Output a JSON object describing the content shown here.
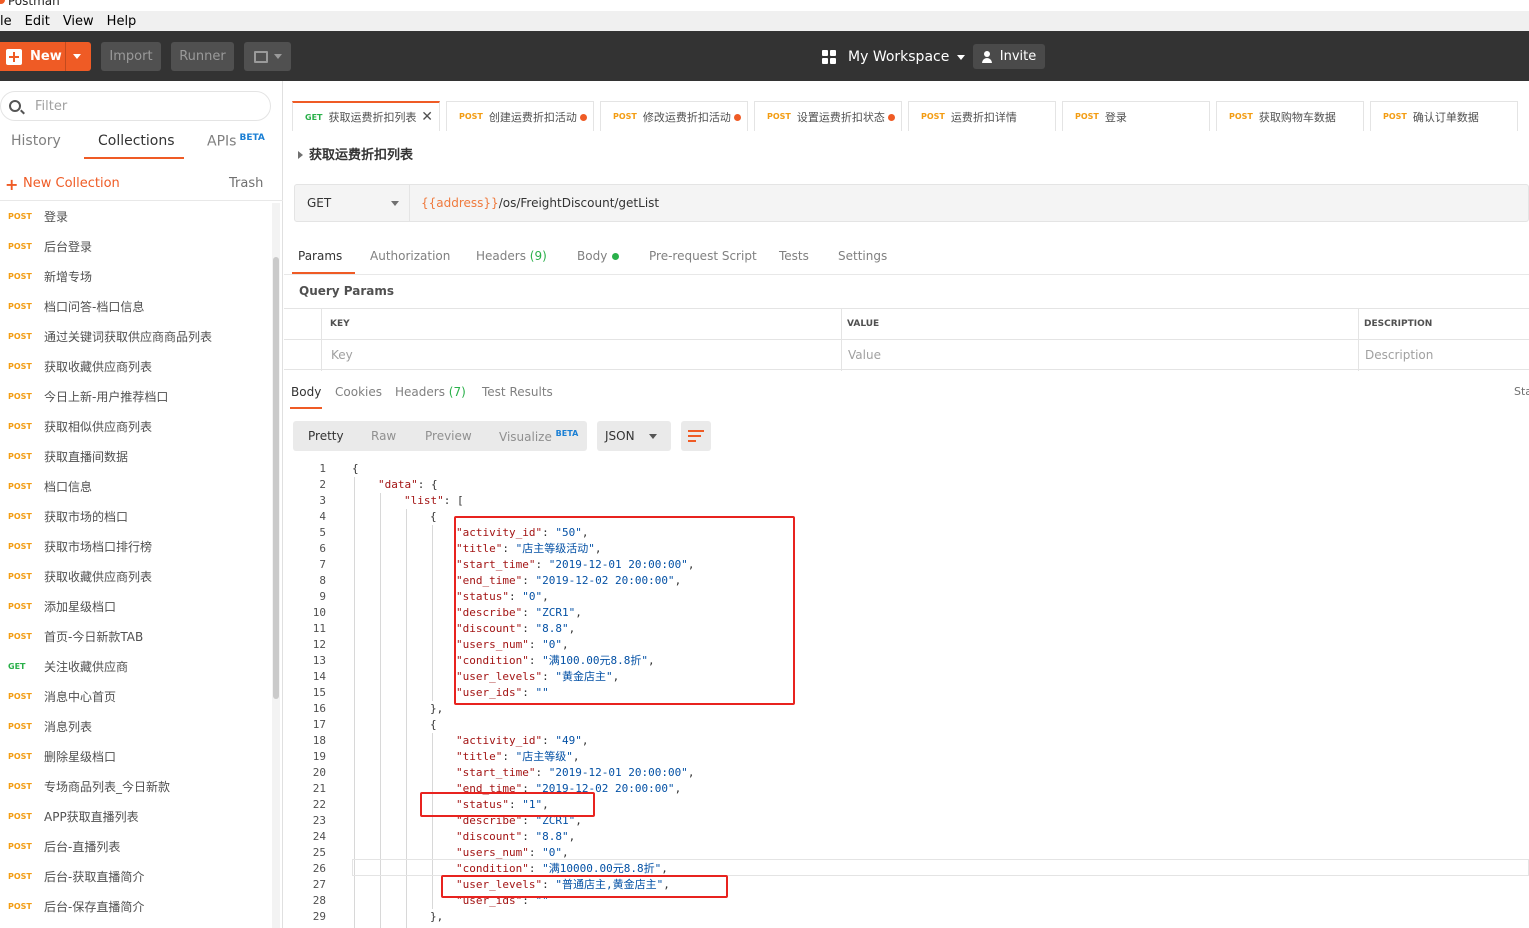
{
  "titlebar": {
    "title": "Postman"
  },
  "menu": [
    "le",
    "Edit",
    "View",
    "Help"
  ],
  "header": {
    "new_label": "New",
    "import_label": "Import",
    "runner_label": "Runner",
    "workspace_label": "My Workspace",
    "invite_label": "Invite"
  },
  "sidebar": {
    "filter_placeholder": "Filter",
    "tabs": {
      "history": "History",
      "collections": "Collections",
      "apis": "APIs",
      "apis_badge": "BETA"
    },
    "new_collection": "New Collection",
    "trash": "Trash",
    "items": [
      {
        "method": "POST",
        "name": "登录"
      },
      {
        "method": "POST",
        "name": "后台登录"
      },
      {
        "method": "POST",
        "name": "新增专场"
      },
      {
        "method": "POST",
        "name": "档口问答-档口信息"
      },
      {
        "method": "POST",
        "name": "通过关键词获取供应商商品列表"
      },
      {
        "method": "POST",
        "name": "获取收藏供应商列表"
      },
      {
        "method": "POST",
        "name": "今日上新-用户推荐档口"
      },
      {
        "method": "POST",
        "name": "获取相似供应商列表"
      },
      {
        "method": "POST",
        "name": "获取直播间数据"
      },
      {
        "method": "POST",
        "name": "档口信息"
      },
      {
        "method": "POST",
        "name": "获取市场的档口"
      },
      {
        "method": "POST",
        "name": "获取市场档口排行榜"
      },
      {
        "method": "POST",
        "name": "获取收藏供应商列表"
      },
      {
        "method": "POST",
        "name": "添加星级档口"
      },
      {
        "method": "POST",
        "name": "首页-今日新款TAB"
      },
      {
        "method": "GET",
        "name": "关注收藏供应商"
      },
      {
        "method": "POST",
        "name": "消息中心首页"
      },
      {
        "method": "POST",
        "name": "消息列表"
      },
      {
        "method": "POST",
        "name": "删除星级档口"
      },
      {
        "method": "POST",
        "name": "专场商品列表_今日新款"
      },
      {
        "method": "POST",
        "name": "APP获取直播列表"
      },
      {
        "method": "POST",
        "name": "后台-直播列表"
      },
      {
        "method": "POST",
        "name": "后台-获取直播简介"
      },
      {
        "method": "POST",
        "name": "后台-保存直播简介"
      }
    ]
  },
  "request_tabs": [
    {
      "method": "GET",
      "name": "获取运费折扣列表",
      "active": true
    },
    {
      "method": "POST",
      "name": "创建运费折扣活动",
      "dirty": true
    },
    {
      "method": "POST",
      "name": "修改运费折扣活动",
      "dirty": true
    },
    {
      "method": "POST",
      "name": "设置运费折扣状态",
      "dirty": true
    },
    {
      "method": "POST",
      "name": "运费折扣详情"
    },
    {
      "method": "POST",
      "name": "登录"
    },
    {
      "method": "POST",
      "name": "获取购物车数据"
    },
    {
      "method": "POST",
      "name": "确认订单数据"
    }
  ],
  "request": {
    "name": "获取运费折扣列表",
    "method": "GET",
    "url_var": "{{address}}",
    "url_path": "/os/FreightDiscount/getList"
  },
  "param_tabs": {
    "params": "Params",
    "authorization": "Authorization",
    "headers": "Headers",
    "headers_count": "(9)",
    "body": "Body",
    "prerequest": "Pre-request Script",
    "tests": "Tests",
    "settings": "Settings"
  },
  "query_params": {
    "title": "Query Params",
    "col_key": "KEY",
    "col_value": "VALUE",
    "col_desc": "DESCRIPTION",
    "ph_key": "Key",
    "ph_value": "Value",
    "ph_desc": "Description"
  },
  "response_tabs": {
    "body": "Body",
    "cookies": "Cookies",
    "headers": "Headers",
    "headers_count": "(7)",
    "test_results": "Test Results",
    "status_cut": "Sta"
  },
  "view_bar": {
    "pretty": "Pretty",
    "raw": "Raw",
    "preview": "Preview",
    "visualize": "Visualize",
    "visualize_badge": "BETA",
    "format": "JSON"
  },
  "code_lines": [
    {
      "n": "1",
      "ind": 0,
      "t": "{"
    },
    {
      "n": "2",
      "ind": 1,
      "k": "\"data\"",
      "t": ": {"
    },
    {
      "n": "3",
      "ind": 2,
      "k": "\"list\"",
      "t": ": ["
    },
    {
      "n": "4",
      "ind": 3,
      "t": "{"
    },
    {
      "n": "5",
      "ind": 4,
      "k": "\"activity_id\"",
      "v": "\"50\"",
      "t": ","
    },
    {
      "n": "6",
      "ind": 4,
      "k": "\"title\"",
      "v": "\"店主等级活动\"",
      "t": ","
    },
    {
      "n": "7",
      "ind": 4,
      "k": "\"start_time\"",
      "v": "\"2019-12-01 20:00:00\"",
      "t": ","
    },
    {
      "n": "8",
      "ind": 4,
      "k": "\"end_time\"",
      "v": "\"2019-12-02 20:00:00\"",
      "t": ","
    },
    {
      "n": "9",
      "ind": 4,
      "k": "\"status\"",
      "v": "\"0\"",
      "t": ","
    },
    {
      "n": "10",
      "ind": 4,
      "k": "\"describe\"",
      "v": "\"ZCR1\"",
      "t": ","
    },
    {
      "n": "11",
      "ind": 4,
      "k": "\"discount\"",
      "v": "\"8.8\"",
      "t": ","
    },
    {
      "n": "12",
      "ind": 4,
      "k": "\"users_num\"",
      "v": "\"0\"",
      "t": ","
    },
    {
      "n": "13",
      "ind": 4,
      "k": "\"condition\"",
      "v": "\"满100.00元8.8折\"",
      "t": ","
    },
    {
      "n": "14",
      "ind": 4,
      "k": "\"user_levels\"",
      "v": "\"黄金店主\"",
      "t": ","
    },
    {
      "n": "15",
      "ind": 4,
      "k": "\"user_ids\"",
      "v": "\"\"",
      "t": ""
    },
    {
      "n": "16",
      "ind": 3,
      "t": "},"
    },
    {
      "n": "17",
      "ind": 3,
      "t": "{"
    },
    {
      "n": "18",
      "ind": 4,
      "k": "\"activity_id\"",
      "v": "\"49\"",
      "t": ","
    },
    {
      "n": "19",
      "ind": 4,
      "k": "\"title\"",
      "v": "\"店主等级\"",
      "t": ","
    },
    {
      "n": "20",
      "ind": 4,
      "k": "\"start_time\"",
      "v": "\"2019-12-01 20:00:00\"",
      "t": ","
    },
    {
      "n": "21",
      "ind": 4,
      "k": "\"end_time\"",
      "v": "\"2019-12-02 20:00:00\"",
      "t": ","
    },
    {
      "n": "22",
      "ind": 4,
      "k": "\"status\"",
      "v": "\"1\"",
      "t": ","
    },
    {
      "n": "23",
      "ind": 4,
      "k": "\"describe\"",
      "v": "\"ZCR1\"",
      "t": ","
    },
    {
      "n": "24",
      "ind": 4,
      "k": "\"discount\"",
      "v": "\"8.8\"",
      "t": ","
    },
    {
      "n": "25",
      "ind": 4,
      "k": "\"users_num\"",
      "v": "\"0\"",
      "t": ","
    },
    {
      "n": "26",
      "ind": 4,
      "k": "\"condition\"",
      "v": "\"满10000.00元8.8折\"",
      "t": ","
    },
    {
      "n": "27",
      "ind": 4,
      "k": "\"user_levels\"",
      "v": "\"普通店主,黄金店主\"",
      "t": ","
    },
    {
      "n": "28",
      "ind": 4,
      "k": "\"user_ids\"",
      "v": "\"\"",
      "t": ""
    },
    {
      "n": "29",
      "ind": 3,
      "t": "},"
    }
  ],
  "colors": {
    "accent": "#ef5b25",
    "post": "#f39c12",
    "get": "#2ab04a",
    "highlight": "#e8231f"
  }
}
